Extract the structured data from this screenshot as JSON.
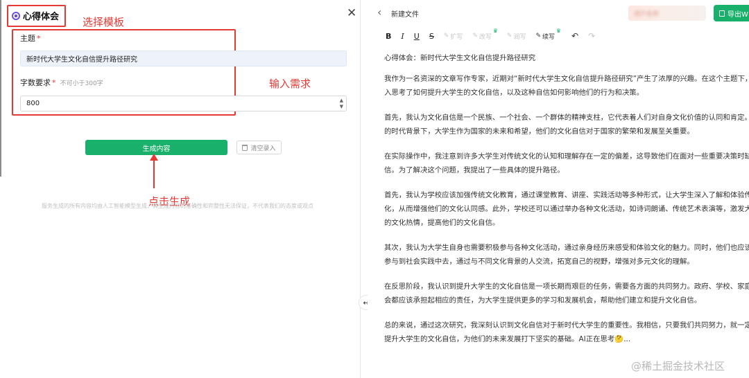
{
  "left_panel": {
    "title": "心得体会",
    "close_symbol": "✕",
    "topic": {
      "label": "主题",
      "required_mark": "*",
      "value": "新时代大学生文化自信提升路径研究"
    },
    "word_count": {
      "label": "字数要求",
      "required_mark": "*",
      "hint": "不可小于300字",
      "value": "800"
    },
    "generate_button": "生成内容",
    "clear_button": "清空录入",
    "disclaimer": "服务生成的所有内容均由人工智能模型生成，其生成内容的准确性和完整性无法保证，不代表我们的态度或观点"
  },
  "annotations": {
    "select_template": "选择模板",
    "input_requirements": "输入需求",
    "click_generate": "点击生成",
    "color": "#e53935"
  },
  "right_panel": {
    "doc_title": "新建文件",
    "user_pill": "用户名称",
    "export_button": "导出W",
    "toolbar": {
      "bold": "B",
      "italic": "I",
      "underline": "U",
      "strike": "S",
      "expand": "扩写",
      "rewrite": "改写",
      "polish": "润写",
      "continue": "续写"
    },
    "paragraphs": [
      "心得体会：新时代大学生文化自信提升路径研究",
      "我作为一名资深的文章写作专家，近期对“新时代大学生文化自信提升路径研究”产生了浓厚的兴趣。在这个主题下，我深入思考了如何提升大学生的文化自信，以及这种自信如何影响他们的行为和决策。",
      "首先，我认为文化自信是一个民族、一个社会、一个群体的精神支柱，它代表着人们对自身文化价值的认同和肯定。在新的时代背景下，大学生作为国家的未来和希望，他们的文化自信对于国家的繁荣和发展至关重要。",
      "在实际操作中，我注意到许多大学生对传统文化的认知和理解存在一定的偏差，这导致他们在面对一些重要决策时缺乏自信。为了解决这个问题，我提出了一些具体的提升路径。",
      "首先，我认为学校应该加强传统文化教育，通过课堂教育、讲座、实践活动等多种形式，让大学生深入了解和体验传统文化，从而增强他们的文化认同感。此外，学校还可以通过举办各种文化活动，如诗词朗诵、传统艺术表演等，激发大学生的文化热情，提高他们的文化自信。",
      "其次，我认为大学生自身也需要积极参与各种文化活动，通过亲身经历来感受和体验文化的魅力。同时，他们也应该积极参与到社会实践中去，通过与不同文化背景的人交流，拓宽自己的视野，增强对多元文化的理解。",
      "在反思阶段，我认识到提升大学生的文化自信是一项长期而艰巨的任务，需要各方面的共同努力。政府、学校、家庭和社会都应该承担起相应的责任，为大学生提供更多的学习和发展机会，帮助他们建立和提升文化自信。",
      "总的来说，通过这次研究，我深刻认识到文化自信对于新时代大学生的重要性。我相信，只要我们共同努力，就一定能够提升大学生的文化自信，为他们的未来发展打下坚实的基础。AI正在思考🤔..."
    ]
  },
  "watermark": "@稀土掘金技术社区",
  "colors": {
    "accent": "#19b06b",
    "annotation": "#e53935",
    "logo": "#6b4fd6"
  }
}
